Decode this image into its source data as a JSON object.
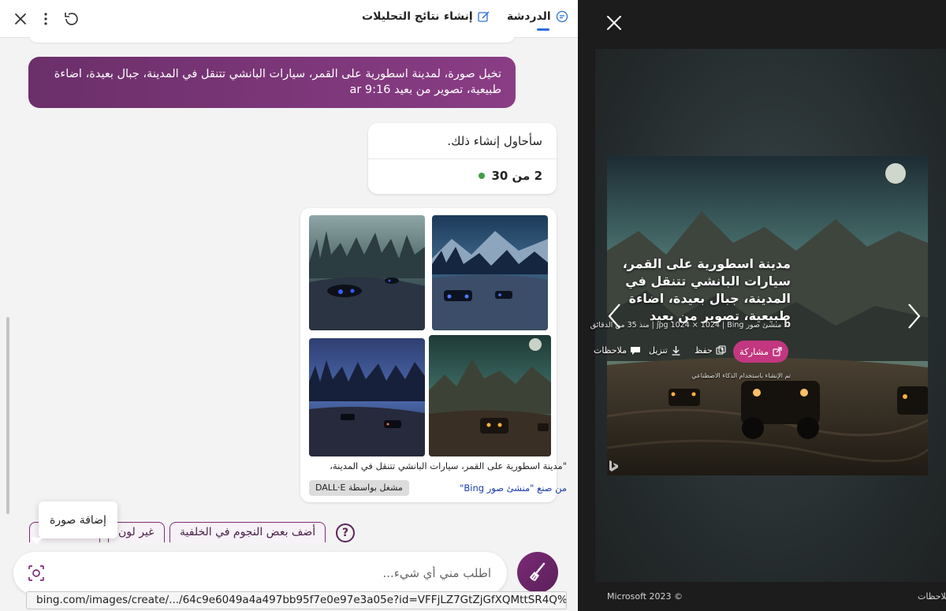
{
  "header": {
    "tabs": [
      {
        "label": "الدردشة",
        "active": true
      },
      {
        "label": "إنشاء",
        "active": false
      },
      {
        "label": "نتائج التحليلات",
        "active": false
      }
    ]
  },
  "conversation": {
    "user_message": "تخيل صورة، لمدينة اسطورية على القمر، سيارات البانشي تتنقل في المدينة، جبال بعيدة، اضاءة طبيعية، تصوير من بعيد ar 9:16",
    "bot_reply": "سأحاول إنشاء ذلك.",
    "counter": "2 من 30",
    "image_caption": "\"مدينة اسطورية على القمر، سيارات البانشي تتنقل في المدينة، جبال بعيدة...\"",
    "made_by": "من صنع \"منشئ صور Bing\"",
    "powered_by": "مشغل بواسطة DALL·E"
  },
  "suggestions": [
    {
      "label": "أضف بعض النجوم في الخلفية"
    },
    {
      "label": "غير لون"
    }
  ],
  "help_label": "?",
  "tooltip": "إضافة صورة",
  "input": {
    "placeholder": "اطلب مني أي شيء..."
  },
  "status_url": "bing.com/images/create/.../64c9e6049a4a497bb95f7e0e97e3a05e?id=VFFjLZ7GtZjGfXQMttSR4Q%3d%3d...",
  "viewer": {
    "title": "مدينة اسطورية على القمر، سيارات البانشي تتنقل في المدينة، جبال بعيدة، اضاءة طبيعية، تصوير من بعيد",
    "meta": "منشئ صور jpg 1024 × 1024 | Bing | منذ 35 من الدقائق",
    "bing_letter": "b",
    "share": "مشاركة",
    "save": "حفظ",
    "download": "تنزيل",
    "notes": "ملاحظات",
    "ai_note": "تم الإنشاء باستخدام الذكاء الاصطناعي",
    "copyright": "Microsoft 2023 ©",
    "feedback_footer": "ملاحظات"
  },
  "colors": {
    "accent_purple": "#7a2c78",
    "tab_underline": "#2c6fd8",
    "share_pink": "#c2377f",
    "status_green": "#3ea043"
  }
}
